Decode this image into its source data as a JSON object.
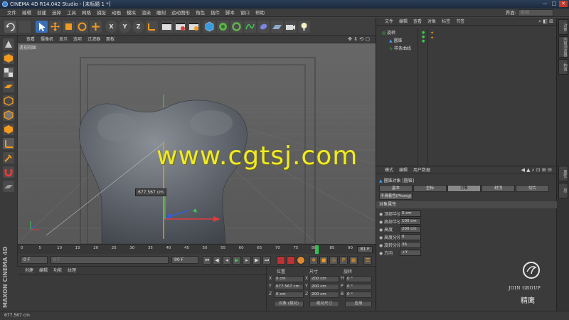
{
  "window": {
    "title": "CINEMA 4D R14.042 Studio - [未标题 1 *]",
    "controls": [
      "—",
      "□",
      "✕"
    ]
  },
  "menubar": {
    "items": [
      "文件",
      "编辑",
      "创建",
      "选择",
      "工具",
      "网格",
      "捕捉",
      "动画",
      "模拟",
      "渲染",
      "雕刻",
      "运动图形",
      "角色",
      "插件",
      "脚本",
      "窗口",
      "帮助"
    ],
    "layout_label": "界面:",
    "layout_value": "启动"
  },
  "toolbar": {
    "axis_x": "X",
    "axis_y": "Y",
    "axis_z": "Z"
  },
  "viewport": {
    "menu": [
      "查看",
      "摄像机",
      "显示",
      "选项",
      "过滤器",
      "面板"
    ],
    "title": "透视视图",
    "distance_readout": "677.567 cm",
    "watermark": "www.cgtsj.com"
  },
  "timeline": {
    "ticks": [
      "0",
      "5",
      "10",
      "15",
      "20",
      "25",
      "30",
      "35",
      "40",
      "45",
      "50",
      "55",
      "60",
      "65",
      "70",
      "75",
      "80",
      "85",
      "90"
    ],
    "current_frame": "81 F",
    "playhead_frame": 81
  },
  "transport": {
    "start_frame": "0 F",
    "current_field": "0 F",
    "end_frame": "90 F"
  },
  "material_manager": {
    "menu": [
      "创建",
      "编辑",
      "功能",
      "纹理"
    ],
    "brand_line1": "MAXON",
    "brand_line2": "CINEMA 4D"
  },
  "coordinates": {
    "headers": {
      "position": "位置",
      "size": "尺寸",
      "rotation": "旋转"
    },
    "rows": [
      {
        "axis": "X",
        "pos": "0 cm",
        "size": "200 cm",
        "rot_label": "H",
        "rot": "0 °"
      },
      {
        "axis": "Y",
        "pos": "677.567 cm",
        "size": "200 cm",
        "rot_label": "P",
        "rot": "0 °"
      },
      {
        "axis": "Z",
        "pos": "0 cm",
        "size": "200 cm",
        "rot_label": "B",
        "rot": "0 °"
      }
    ],
    "mode_select": "对象 (相对)",
    "size_select": "绝对尺寸",
    "apply_button": "应用"
  },
  "statusbar": {
    "text": "677.567 cm"
  },
  "object_manager": {
    "menu": [
      "文件",
      "编辑",
      "查看",
      "对象",
      "标签",
      "书签"
    ],
    "objects": [
      {
        "name": "旋转",
        "indent": 0
      },
      {
        "name": "圆锥",
        "indent": 1
      },
      {
        "name": "样条曲线",
        "indent": 1
      }
    ]
  },
  "right_tabs": [
    "对象",
    "内容浏览器",
    "构造",
    "属性",
    "层"
  ],
  "attribute_manager": {
    "menu": [
      "模式",
      "编辑",
      "用户数据"
    ],
    "object_title": "圆锥对象 [圆锥]",
    "tabs": [
      "基本",
      "坐标",
      "对象",
      "封顶",
      "切片"
    ],
    "active_tab": "对象",
    "extra_tab": "平滑着色(Phong)",
    "section": "对象属性",
    "params": [
      {
        "label": "顶部半径",
        "value": "0 cm"
      },
      {
        "label": "底部半径",
        "value": "100 cm"
      },
      {
        "label": "高度",
        "value": "200 cm"
      },
      {
        "label": "高度分段",
        "value": "8"
      },
      {
        "label": "旋转分段",
        "value": "36"
      },
      {
        "label": "方向",
        "value": "+Y"
      }
    ]
  },
  "logo": {
    "english": "JOIN GROUP",
    "chinese": "精鹰"
  },
  "colors": {
    "watermark": "#f0ea24",
    "playhead": "#31c351",
    "accent_blue": "#3a7fd5",
    "x_axis": "#e23b3b",
    "y_axis": "#3cc94a",
    "z_axis": "#2f5fe0",
    "gizmo_orange": "#f39a1e"
  }
}
